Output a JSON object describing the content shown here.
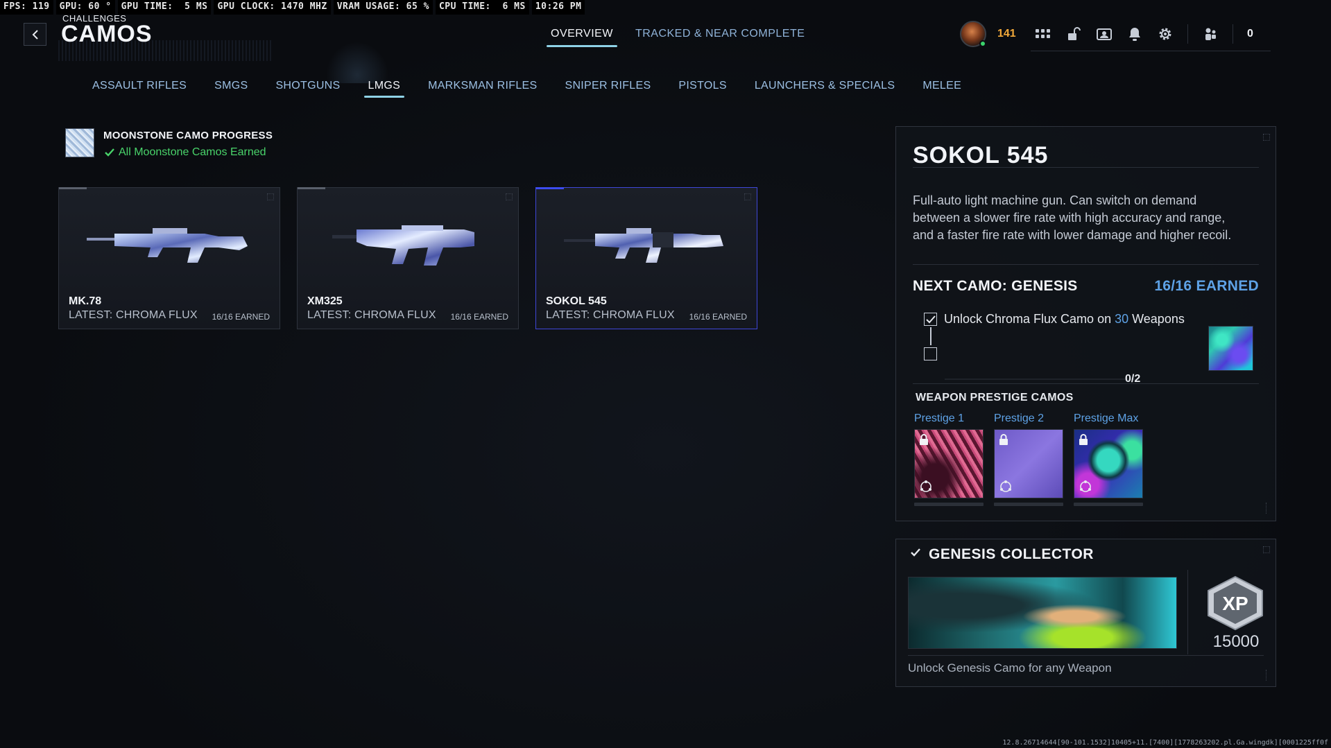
{
  "perf": {
    "fps": "FPS: 119",
    "gpu": "GPU: 60 °",
    "gpu_time": "GPU TIME:  5 MS",
    "gpu_clock": "GPU CLOCK: 1470 MHZ",
    "vram": "VRAM USAGE: 65 %",
    "cpu_time": "CPU TIME:  6 MS",
    "clock": "10:26 PM"
  },
  "header": {
    "breadcrumb": "CHALLENGES",
    "title": "CAMOS",
    "tabs": [
      {
        "label": "OVERVIEW",
        "active": true
      },
      {
        "label": "TRACKED & NEAR COMPLETE",
        "active": false
      }
    ],
    "level": "141",
    "party_count": "0"
  },
  "categories": [
    {
      "label": "ASSAULT RIFLES",
      "active": false
    },
    {
      "label": "SMGS",
      "active": false
    },
    {
      "label": "SHOTGUNS",
      "active": false
    },
    {
      "label": "LMGS",
      "active": true
    },
    {
      "label": "MARKSMAN RIFLES",
      "active": false
    },
    {
      "label": "SNIPER RIFLES",
      "active": false
    },
    {
      "label": "PISTOLS",
      "active": false
    },
    {
      "label": "LAUNCHERS & SPECIALS",
      "active": false
    },
    {
      "label": "MELEE",
      "active": false
    }
  ],
  "moonstone": {
    "title": "MOONSTONE CAMO PROGRESS",
    "status": "All Moonstone Camos Earned"
  },
  "weapons": [
    {
      "name": "MK.78",
      "latest": "LATEST: CHROMA FLUX",
      "earned": "16/16 EARNED",
      "selected": false
    },
    {
      "name": "XM325",
      "latest": "LATEST: CHROMA FLUX",
      "earned": "16/16 EARNED",
      "selected": false
    },
    {
      "name": "SOKOL 545",
      "latest": "LATEST: CHROMA FLUX",
      "earned": "16/16 EARNED",
      "selected": true
    }
  ],
  "detail": {
    "title": "SOKOL 545",
    "description": "Full-auto light machine gun. Can switch on demand between a slower fire rate with high accuracy and range, and a faster fire rate with lower damage and higher recoil.",
    "next_camo": "NEXT CAMO: GENESIS",
    "next_earned": "16/16 EARNED",
    "requirement": {
      "prefix": "Unlock Chroma Flux Camo on ",
      "count": "30",
      "suffix": " Weapons",
      "checked": true
    },
    "progress": "0/2",
    "progress_fraction": 0,
    "prestige_title": "WEAPON PRESTIGE CAMOS",
    "prestige": [
      {
        "label": "Prestige 1",
        "locked": true
      },
      {
        "label": "Prestige 2",
        "locked": true
      },
      {
        "label": "Prestige Max",
        "locked": true
      }
    ]
  },
  "collector": {
    "title": "GENESIS COLLECTOR",
    "xp_label": "XP",
    "xp_amount": "15000",
    "description": "Unlock Genesis Camo for any Weapon"
  },
  "build": "12.8.26714644[90-101.1532]10405+11.[7400][1778263202.pl.Ga.wingdk][0001225ff0f"
}
